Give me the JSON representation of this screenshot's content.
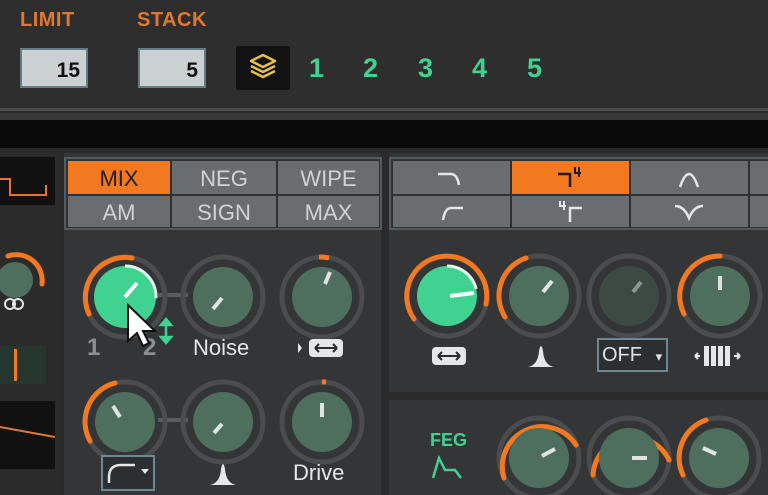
{
  "header": {
    "limit_label": "LIMIT",
    "limit_value": "15",
    "stack_label": "STACK",
    "stack_value": "5",
    "layers_icon": "layers-icon",
    "stack_numbers": [
      "1",
      "2",
      "3",
      "4",
      "5"
    ]
  },
  "mix_modes": {
    "row1": [
      "MIX",
      "NEG",
      "WIPE"
    ],
    "row2": [
      "AM",
      "SIGN",
      "MAX"
    ],
    "active": "MIX"
  },
  "filter_modes": {
    "icons_row1": [
      "lowpass-icon",
      "lowpass-4pole-icon",
      "bandpass-icon"
    ],
    "icons_row2": [
      "highpass-icon",
      "highpass-4pole-icon",
      "notch-icon"
    ],
    "active": "lowpass-4pole-icon"
  },
  "osc_section": {
    "knob1_label_a": "1",
    "knob1_label_b": "2",
    "noise_label": "Noise",
    "drive_label": "Drive",
    "width_icon": "stereo-width-icon",
    "shape_icon": "waveshape-icon",
    "resonance_icon": "resonance-icon"
  },
  "filter_section": {
    "dropdown_value": "OFF",
    "dropdown_arrow": "▾",
    "width_icon": "stereo-width-icon",
    "resonance_icon": "resonance-icon",
    "keytrack_icon": "keyboard-tracking-icon"
  },
  "feg": {
    "label": "FEG",
    "icon": "envelope-icon"
  },
  "colors": {
    "accent_orange": "#f2791f",
    "accent_green": "#3fd291",
    "knob_body": "#4e6e5e"
  }
}
